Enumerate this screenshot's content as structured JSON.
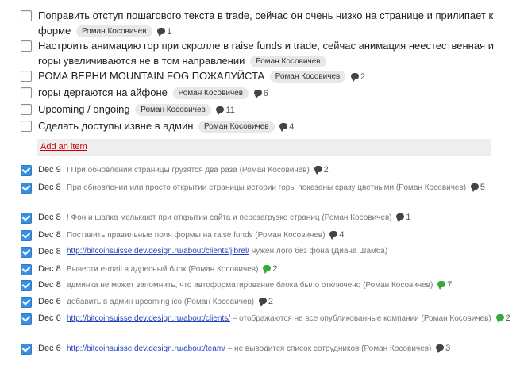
{
  "add_item_label": "Add an item",
  "open_items": [
    {
      "text": "Поправить отступ пошагового текста в trade, сейчас он очень низко на странице и прилипает к форме",
      "assignee": "Роман Косовичев",
      "comments": "1"
    },
    {
      "text": "Настроить анимацию гор при скролле в raise funds и trade, сейчас анимация неестественная и горы увеличиваются не в том направлении",
      "assignee": "Роман Косовичев",
      "comments": ""
    },
    {
      "text": "РОМА ВЕРНИ MOUNTAIN FOG ПОЖАЛУЙСТА",
      "assignee": "Роман Косовичев",
      "comments": "2"
    },
    {
      "text": "горы дергаются на айфоне",
      "assignee": "Роман Косовичев",
      "comments": "6"
    },
    {
      "text": "Upcoming / ongoing",
      "assignee": "Роман Косовичев",
      "comments": "11"
    },
    {
      "text": "Сделать доступы извне в админ",
      "assignee": "Роман Косовичев",
      "comments": "4"
    }
  ],
  "done_items": [
    {
      "date": "Dec 9",
      "link": "",
      "text": "! При обновлении страницы грузятся два раза (Роман Косовичев)",
      "comments": "2",
      "bubble_color": "#444444"
    },
    {
      "date": "Dec 8",
      "link": "",
      "text": "При обновлении или просто открытии страницы истории горы показаны сразу цветными (Роман Косовичев)",
      "comments": "5",
      "bubble_color": "#444444"
    },
    {
      "date": "Dec 8",
      "link": "",
      "text": "! Фон и шапка мелькают при открытии сайта и перезагрузке страниц (Роман Косовичев)",
      "comments": "1",
      "bubble_color": "#444444"
    },
    {
      "date": "Dec 8",
      "link": "",
      "text": "Поставить правильные поля формы на raise funds (Роман Косовичев)",
      "comments": "4",
      "bubble_color": "#444444"
    },
    {
      "date": "Dec 8",
      "link": "http://bitcoinsuisse.dev.design.ru/about/clients/jibrel/",
      "text": "нужен лого без фона (Диана Шамба)",
      "comments": "",
      "bubble_color": ""
    },
    {
      "date": "Dec 8",
      "link": "",
      "text": "Вывести e-mail в адресный блок (Роман Косовичев)",
      "comments": "2",
      "bubble_color": "#3aa83a"
    },
    {
      "date": "Dec 8",
      "link": "",
      "text": "админка не может запомнить, что автоформатирование блока было отключено (Роман Косовичев)",
      "comments": "7",
      "bubble_color": "#3aa83a"
    },
    {
      "date": "Dec 6",
      "link": "",
      "text": "добавить в админ upcoming ico (Роман Косовичев)",
      "comments": "2",
      "bubble_color": "#444444"
    },
    {
      "date": "Dec 6",
      "link": "http://bitcoinsuisse.dev.design.ru/about/clients/",
      "text": "– отображаются не все опубликованные компании (Роман Косовичев)",
      "comments": "2",
      "bubble_color": "#3aa83a"
    },
    {
      "date": "Dec 6",
      "link": "http://bitcoinsuisse.dev.design.ru/about/team/",
      "text": "– не выводится список сотрудников (Роман Косовичев)",
      "comments": "3",
      "bubble_color": "#444444"
    }
  ]
}
